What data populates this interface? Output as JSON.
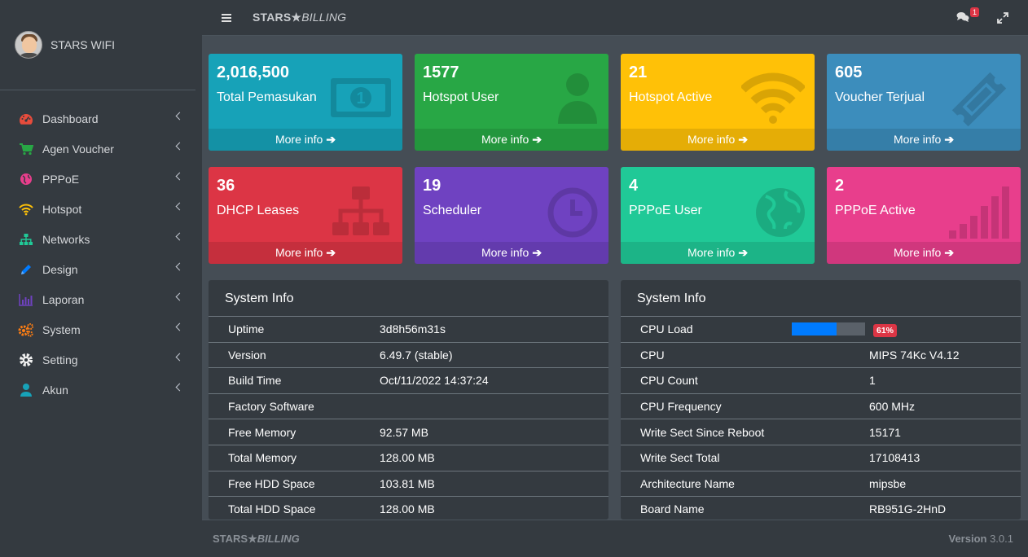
{
  "sidebar": {
    "user_name": "STARS WIFI",
    "items": [
      {
        "label": "Dashboard",
        "icon": "tachometer-icon"
      },
      {
        "label": "Agen Voucher",
        "icon": "cart-icon"
      },
      {
        "label": "PPPoE",
        "icon": "globe-icon"
      },
      {
        "label": "Hotspot",
        "icon": "wifi-icon"
      },
      {
        "label": "Networks",
        "icon": "sitemap-icon"
      },
      {
        "label": "Design",
        "icon": "pencil-icon"
      },
      {
        "label": "Laporan",
        "icon": "bar-chart-icon"
      },
      {
        "label": "System",
        "icon": "cogs-icon"
      },
      {
        "label": "Setting",
        "icon": "gear-icon"
      },
      {
        "label": "Akun",
        "icon": "user-icon"
      }
    ]
  },
  "topbar": {
    "brand_bold": "STARS",
    "brand_star": "★",
    "brand_italic": "BILLING",
    "notification_count": "1"
  },
  "boxes": [
    {
      "value": "2,016,500",
      "title": "Total Pemasukan",
      "more": "More info",
      "color": "#17a2b8",
      "icon": "money-icon"
    },
    {
      "value": "1577",
      "title": "Hotspot User",
      "more": "More info",
      "color": "#28a745",
      "icon": "user-icon"
    },
    {
      "value": "21",
      "title": "Hotspot Active",
      "more": "More info",
      "color": "#ffc107",
      "icon": "wifi-icon"
    },
    {
      "value": "605",
      "title": "Voucher Terjual",
      "more": "More info",
      "color": "#3c8dbc",
      "icon": "ticket-icon"
    },
    {
      "value": "36",
      "title": "DHCP Leases",
      "more": "More info",
      "color": "#dc3545",
      "icon": "sitemap-icon"
    },
    {
      "value": "19",
      "title": "Scheduler",
      "more": "More info",
      "color": "#6f42c1",
      "icon": "clock-icon"
    },
    {
      "value": "4",
      "title": "PPPoE User",
      "more": "More info",
      "color": "#20c997",
      "icon": "globe-icon"
    },
    {
      "value": "2",
      "title": "PPPoE Active",
      "more": "More info",
      "color": "#e83e8c",
      "icon": "signal-icon"
    }
  ],
  "info_left": {
    "title": "System Info",
    "rows": [
      {
        "k": "Uptime",
        "v": "3d8h56m31s"
      },
      {
        "k": "Version",
        "v": "6.49.7 (stable)"
      },
      {
        "k": "Build Time",
        "v": "Oct/11/2022 14:37:24"
      },
      {
        "k": "Factory Software",
        "v": ""
      },
      {
        "k": "Free Memory",
        "v": "92.57 MB"
      },
      {
        "k": "Total Memory",
        "v": "128.00 MB"
      },
      {
        "k": "Free HDD Space",
        "v": "103.81 MB"
      },
      {
        "k": "Total HDD Space",
        "v": "128.00 MB"
      }
    ]
  },
  "info_right": {
    "title": "System Info",
    "cpu_load_label": "CPU Load",
    "cpu_load_pct": "61%",
    "cpu_load_value": 61,
    "rows": [
      {
        "k": "CPU",
        "v": "MIPS 74Kc V4.12"
      },
      {
        "k": "CPU Count",
        "v": "1"
      },
      {
        "k": "CPU Frequency",
        "v": "600 MHz"
      },
      {
        "k": "Write Sect Since Reboot",
        "v": "15171"
      },
      {
        "k": "Write Sect Total",
        "v": "17108413"
      },
      {
        "k": "Architecture Name",
        "v": "mipsbe"
      },
      {
        "k": "Board Name",
        "v": "RB951G-2HnD"
      }
    ]
  },
  "footer": {
    "brand_bold": "STARS",
    "brand_star": "★",
    "brand_italic": "BILLING",
    "version_label": "Version",
    "version_number": "3.0.1"
  }
}
